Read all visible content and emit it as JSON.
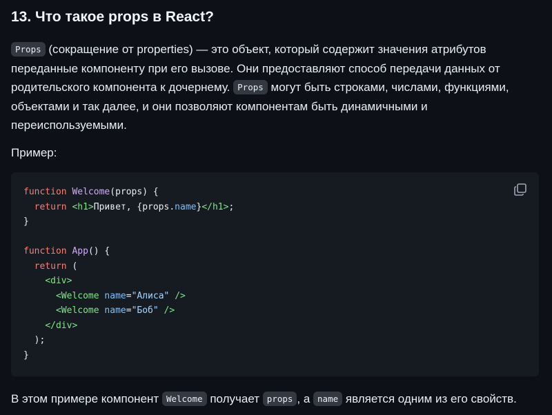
{
  "title": "13. Что такое props в React?",
  "intro": {
    "code1": "Props",
    "text1": " (сокращение от properties) — это объект, который содержит значения атрибутов переданные компоненту при его вызове. Они предоставляют способ передачи данных от родительского компонента к дочернему. ",
    "code2": "Props",
    "text2": " могут быть строками, числами, функциями, объектами и так далее, и они позволяют компонентам быть динамичными и переиспользуемыми."
  },
  "example_label": "Пример:",
  "code": {
    "l1_kw": "function",
    "l1_fn": "Welcome",
    "l1_rest": "(props) {",
    "l2_kw": "return",
    "l2_tag_open": "<h1>",
    "l2_text": "Привет, {props.",
    "l2_attr": "name",
    "l2_text2": "}",
    "l2_tag_close": "</h1>",
    "l2_end": ";",
    "l3": "}",
    "l5_kw": "function",
    "l5_fn": "App",
    "l5_rest": "() {",
    "l6_kw": "return",
    "l6_rest": " (",
    "l7_tag": "<div>",
    "l8_tag": "<Welcome",
    "l8_attr": "name",
    "l8_eq": "=",
    "l8_str": "\"Алиса\"",
    "l8_close": "/>",
    "l9_tag": "<Welcome",
    "l9_attr": "name",
    "l9_eq": "=",
    "l9_str": "\"Боб\"",
    "l9_close": "/>",
    "l10_tag": "</div>",
    "l11": ");",
    "l12": "}"
  },
  "copy_icon": "copy-icon",
  "footer": {
    "t1": "В этом примере компонент ",
    "c1": "Welcome",
    "t2": " получает ",
    "c2": "props",
    "t3": ", а ",
    "c3": "name",
    "t4": " является одним из его свойств."
  }
}
